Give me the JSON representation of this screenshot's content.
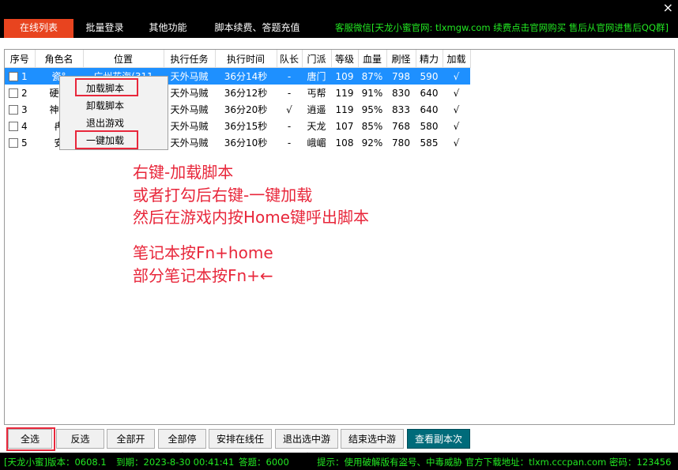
{
  "tabs": [
    {
      "label": "在线列表",
      "active": true
    },
    {
      "label": "批量登录",
      "active": false
    },
    {
      "label": "其他功能",
      "active": false
    },
    {
      "label": "脚本续费、答题充值",
      "active": false
    }
  ],
  "notice": "客服微信[天龙小蜜官网: tlxmgw.com 续费点击官网购买 售后从官网进售后QQ群]",
  "close_glyph": "×",
  "table": {
    "headers": [
      "序号",
      "角色名",
      "位置",
      "执行任务",
      "执行时间",
      "队长",
      "门派",
      "等级",
      "血量",
      "刷怪",
      "精力",
      "加载"
    ],
    "rows": [
      {
        "no": "1",
        "name": "瓷°",
        "pos": "广州花海(311",
        "task": "天外马贼",
        "time": "36分14秒",
        "leader": "-",
        "school": "唐门",
        "level": "109",
        "hp": "87%",
        "kills": "798",
        "energy": "590",
        "loaded": "√",
        "selected": true
      },
      {
        "no": "2",
        "name": "硬碰",
        "pos": "",
        "task": "天外马贼",
        "time": "36分12秒",
        "leader": "-",
        "school": "丐帮",
        "level": "119",
        "hp": "91%",
        "kills": "830",
        "energy": "640",
        "loaded": "√",
        "selected": false
      },
      {
        "no": "3",
        "name": "神话",
        "pos": "",
        "task": "天外马贼",
        "time": "36分20秒",
        "leader": "√",
        "school": "逍遥",
        "level": "119",
        "hp": "95%",
        "kills": "833",
        "energy": "640",
        "loaded": "√",
        "selected": false
      },
      {
        "no": "4",
        "name": "冉",
        "pos": "",
        "task": "天外马贼",
        "time": "36分15秒",
        "leader": "-",
        "school": "天龙",
        "level": "107",
        "hp": "85%",
        "kills": "768",
        "energy": "580",
        "loaded": "√",
        "selected": false
      },
      {
        "no": "5",
        "name": "安",
        "pos": "",
        "task": "天外马贼",
        "time": "36分10秒",
        "leader": "-",
        "school": "峨嵋",
        "level": "108",
        "hp": "92%",
        "kills": "780",
        "energy": "585",
        "loaded": "√",
        "selected": false
      }
    ]
  },
  "context_menu": [
    "加载脚本",
    "卸载脚本",
    "退出游戏",
    "一键加载"
  ],
  "instructions": [
    "右键-加载脚本",
    "或者打勾后右键-一键加载",
    "然后在游戏内按Home键呼出脚本",
    "笔记本按Fn+home",
    "部分笔记本按Fn+←"
  ],
  "buttons": [
    "全选",
    "反选",
    "全部开始",
    "全部停止",
    "安排在线任务",
    "退出选中游戏",
    "结束选中游戏",
    "查看副本次数"
  ],
  "status": {
    "version": "[天龙小蜜]版本：0608.1",
    "expiry": "到期：2023-8-30 00:41:41",
    "answers": "答题：6000",
    "tip": "提示：使用破解版有盗号、中毒威胁 官方下载地址：tlxm.cccpan.com 密码：123456"
  },
  "colors": {
    "accent": "#e8441f",
    "highlight": "#1e90ff",
    "annotation": "#e8273b",
    "status_text": "#22e822"
  }
}
